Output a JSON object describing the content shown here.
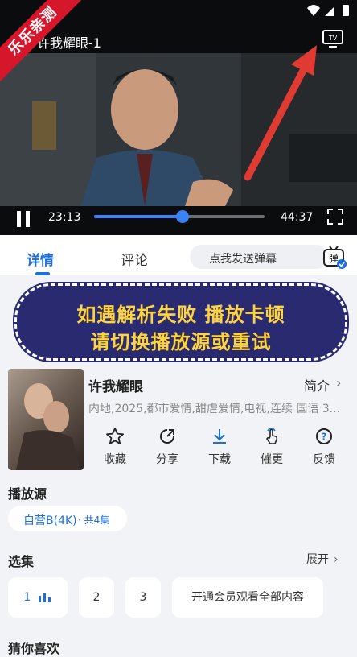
{
  "video": {
    "title": "许我耀眼-1",
    "watermark": "乐乐亲测",
    "current_time": "23:13",
    "total_time": "44:37",
    "progress": 0.52
  },
  "tabs": [
    {
      "label": "详情",
      "active": true
    },
    {
      "label": "评论",
      "active": false
    }
  ],
  "danmaku": {
    "placeholder": "点我发送弹幕",
    "button_label": "弹"
  },
  "banner": {
    "line1": "如遇解析失败 播放卡顿",
    "line2": "请切换播放源或重试"
  },
  "show": {
    "title": "许我耀眼",
    "intro": "简介",
    "meta": "内地,2025,都市爱情,甜虐爱情,电视,连续 国语 3..."
  },
  "actions": [
    {
      "label": "收藏",
      "icon": "star-icon"
    },
    {
      "label": "分享",
      "icon": "share-icon"
    },
    {
      "label": "下载",
      "icon": "download-icon"
    },
    {
      "label": "催更",
      "icon": "urge-icon"
    },
    {
      "label": "反馈",
      "icon": "feedback-icon"
    }
  ],
  "source": {
    "title": "播放源",
    "name": "自营B(4K)",
    "count": "· 共4集"
  },
  "episodes": {
    "title": "选集",
    "expand": "展开",
    "items": [
      "1",
      "2",
      "3"
    ],
    "vip": "开通会员观看全部内容"
  },
  "guess": {
    "title": "猜你喜欢"
  },
  "colors": {
    "accent": "#1e6fd9",
    "banner_bg": "#2a2a70",
    "banner_text": "#ffd43b",
    "ribbon": "#d6172b"
  }
}
